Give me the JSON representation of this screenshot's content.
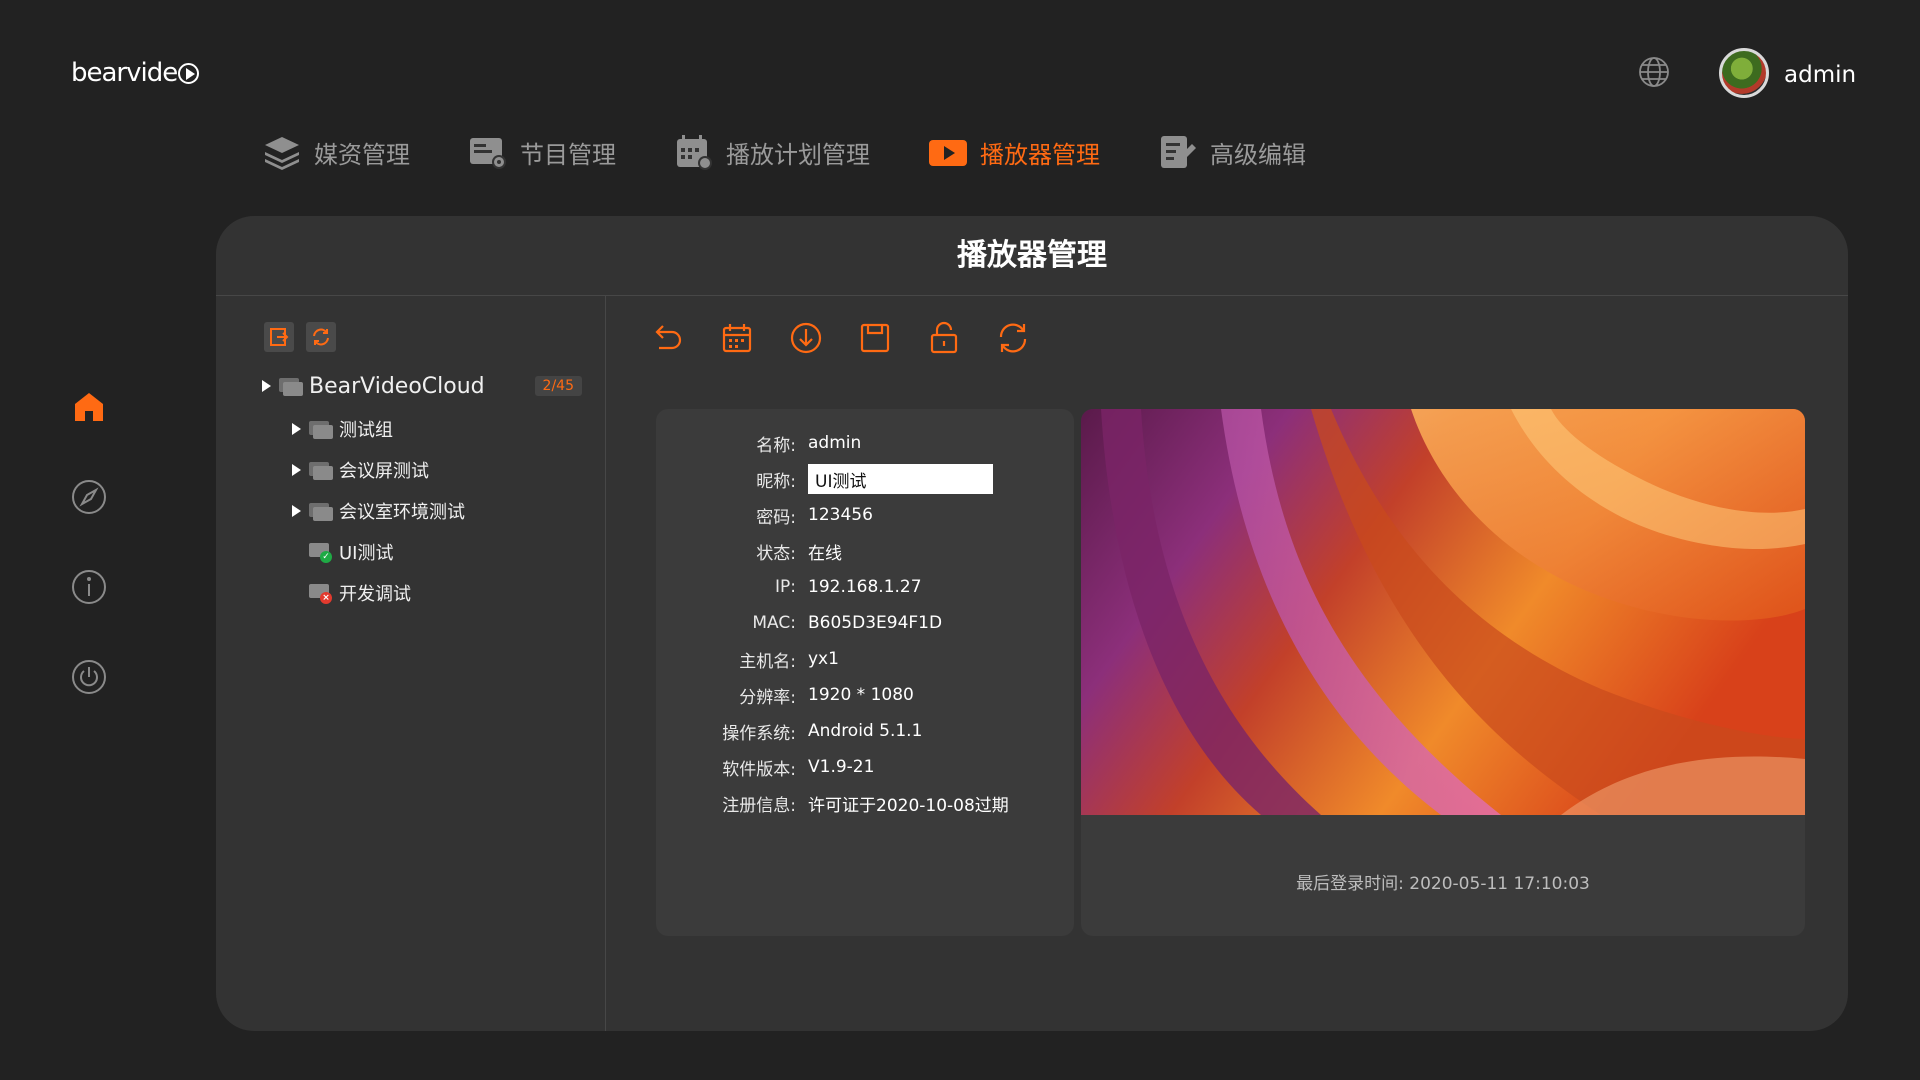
{
  "brand": {
    "logo_text": "bearvide"
  },
  "header": {
    "user_name": "admin"
  },
  "nav": [
    {
      "label": "媒资管理",
      "icon": "layers-icon",
      "active": false
    },
    {
      "label": "节目管理",
      "icon": "program-icon",
      "active": false
    },
    {
      "label": "播放计划管理",
      "icon": "calendar-icon",
      "active": false
    },
    {
      "label": "播放器管理",
      "icon": "player-icon",
      "active": true
    },
    {
      "label": "高级编辑",
      "icon": "edit-icon",
      "active": false
    }
  ],
  "colors": {
    "accent": "#ff6a13",
    "background": "#222222",
    "panel": "#333333",
    "card": "#3b3b3b",
    "online": "#1faa45",
    "offline": "#e23a2e"
  },
  "panel": {
    "title": "播放器管理"
  },
  "tree": {
    "root": {
      "label": "BearVideoCloud",
      "count": "2/45"
    },
    "nodes": [
      {
        "label": "测试组",
        "type": "group"
      },
      {
        "label": "会议屏测试",
        "type": "group"
      },
      {
        "label": "会议室环境测试",
        "type": "group"
      },
      {
        "label": "UI测试",
        "type": "device",
        "status": "online"
      },
      {
        "label": "开发调试",
        "type": "device",
        "status": "offline"
      }
    ]
  },
  "info": {
    "name_label": "名称:",
    "name_value": "admin",
    "nick_label": "昵称:",
    "nick_value": "UI测试",
    "pwd_label": "密码:",
    "pwd_value": "123456",
    "status_label": "状态:",
    "status_value": "在线",
    "ip_label": "IP:",
    "ip_value": "192.168.1.27",
    "mac_label": "MAC:",
    "mac_value": "B605D3E94F1D",
    "host_label": "主机名:",
    "host_value": "yx1",
    "res_label": "分辨率:",
    "res_value": "1920 * 1080",
    "os_label": "操作系统:",
    "os_value": "Android 5.1.1",
    "ver_label": "软件版本:",
    "ver_value": "V1.9-21",
    "reg_label": "注册信息:",
    "reg_value": "许可证于2020-10-08过期"
  },
  "preview": {
    "last_login": "最后登录时间: 2020-05-11 17:10:03"
  }
}
